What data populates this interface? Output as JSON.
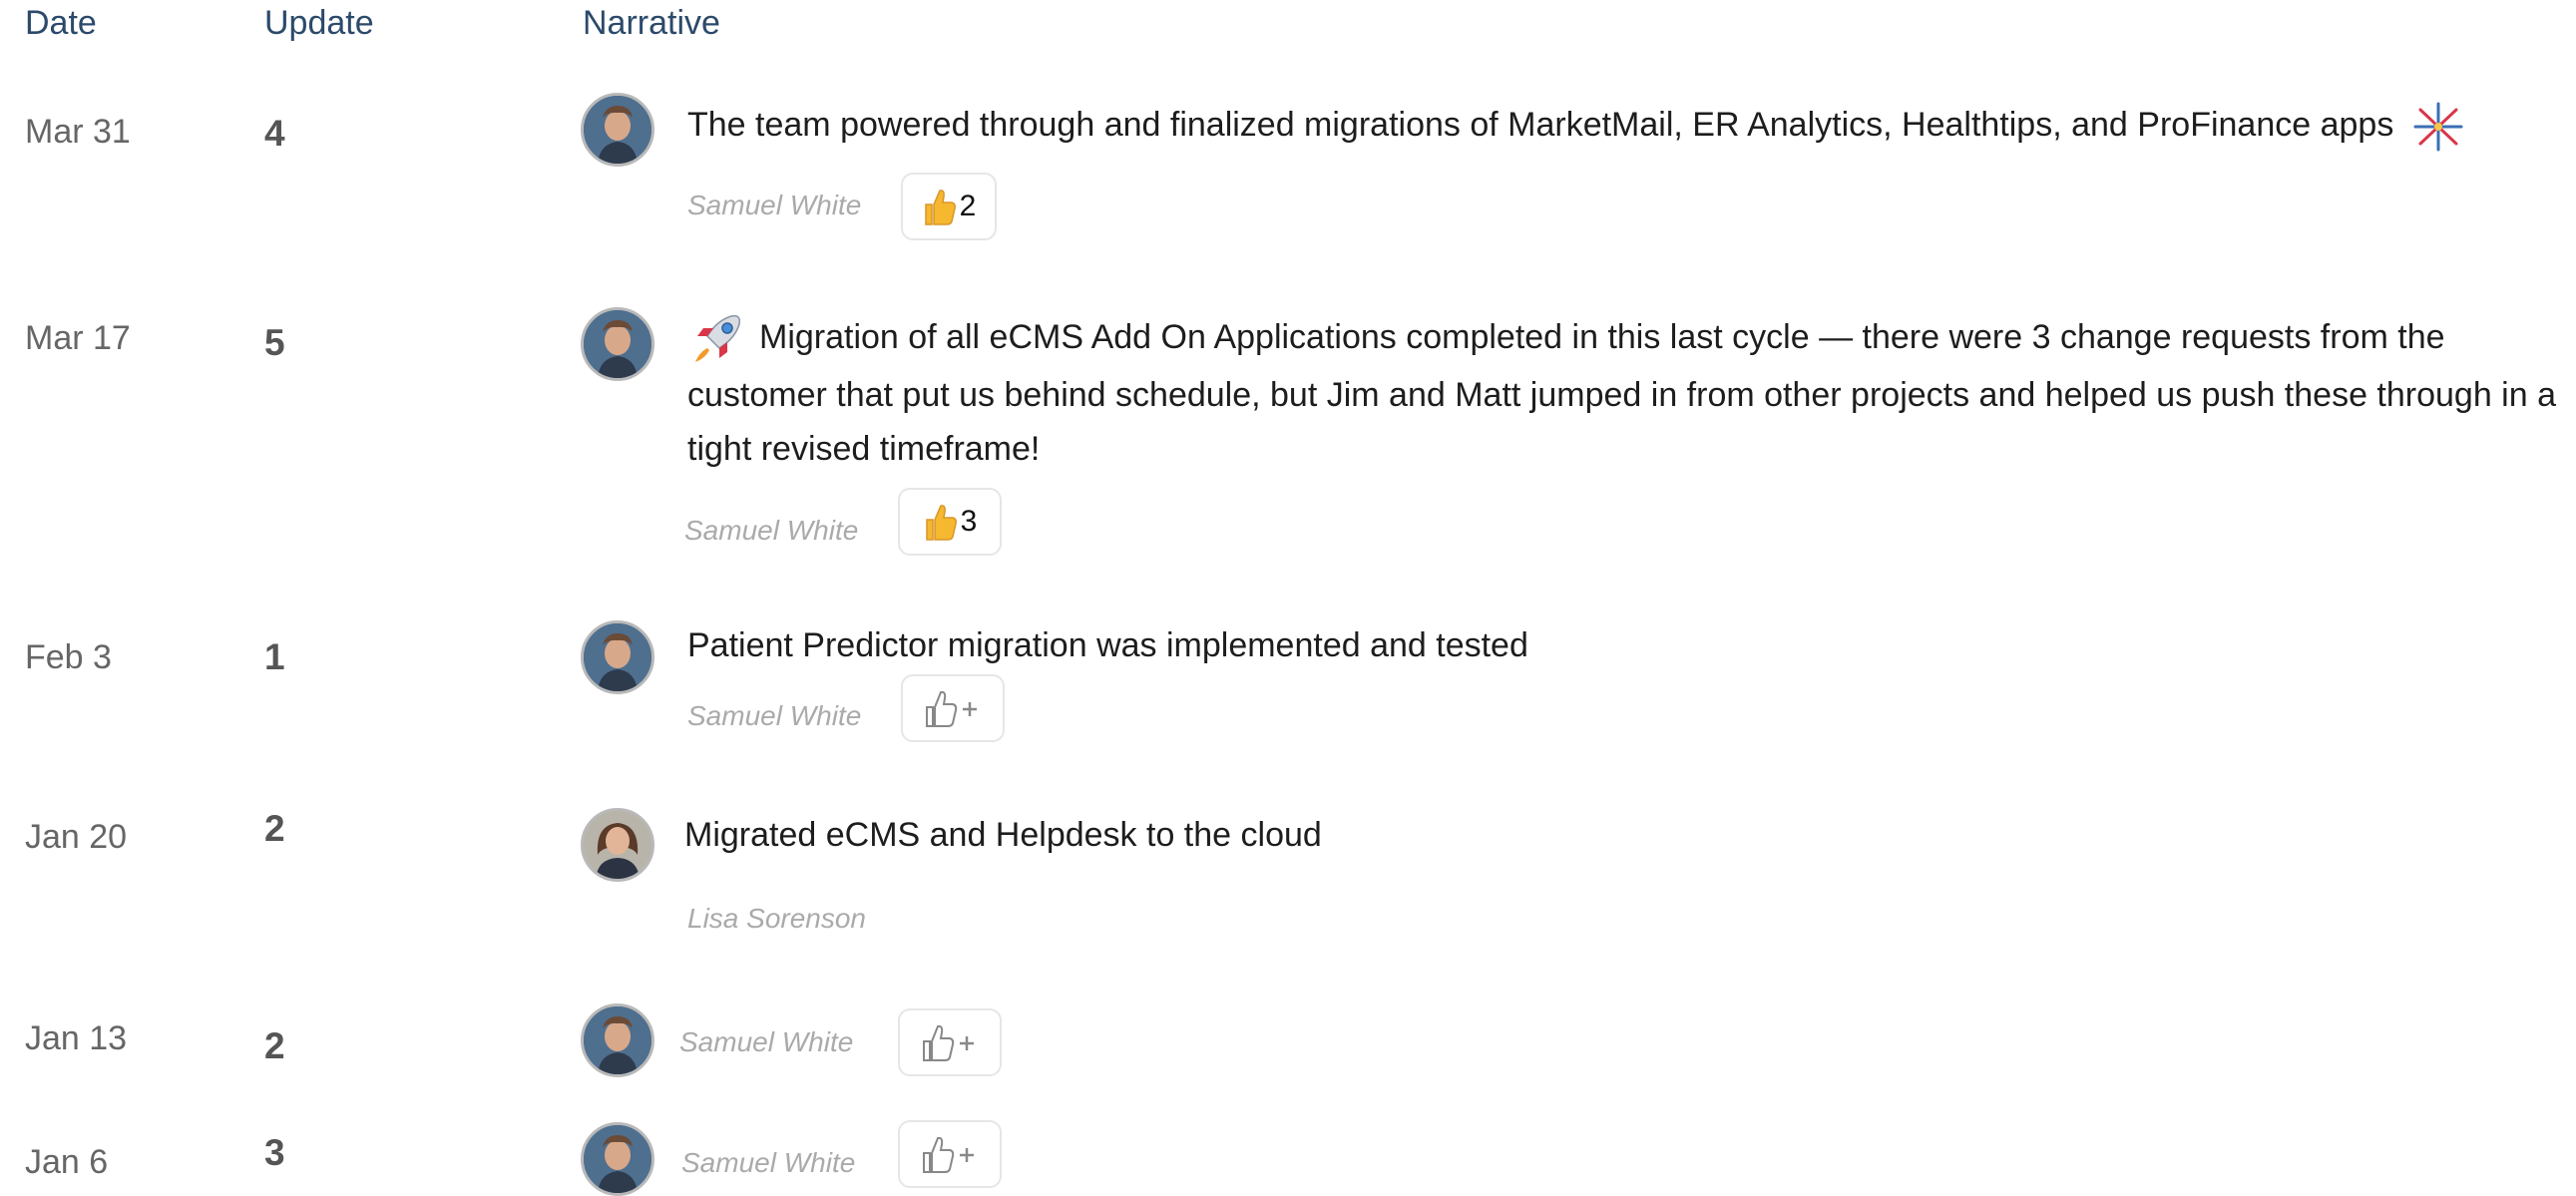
{
  "headers": {
    "date": "Date",
    "update": "Update",
    "narrative": "Narrative"
  },
  "rows": [
    {
      "date": "Mar 31",
      "update": "4",
      "narrative": "The team powered through and finalized migrations of MarketMail, ER Analytics, Healthtips, and ProFinance apps",
      "author": "Samuel White",
      "reaction_count": "2",
      "trailing_emoji": "fireworks-icon"
    },
    {
      "date": "Mar 17",
      "update": "5",
      "narrative": "Migration of all eCMS Add On Applications completed in this last cycle — there were 3 change requests from the customer that put us behind schedule, but Jim and Matt jumped in from other projects and helped us push these through in a tight revised timeframe!",
      "author": "Samuel White",
      "reaction_count": "3",
      "leading_emoji": "rocket-icon"
    },
    {
      "date": "Feb 3",
      "update": "1",
      "narrative": "Patient Predictor migration was implemented and tested",
      "author": "Samuel White",
      "reaction_count": ""
    },
    {
      "date": "Jan 20",
      "update": "2",
      "narrative": "Migrated eCMS and Helpdesk to the cloud",
      "author": "Lisa Sorenson"
    },
    {
      "date": "Jan 13",
      "update": "2",
      "narrative": "",
      "author": "Samuel White",
      "reaction_count": ""
    },
    {
      "date": "Jan 6",
      "update": "3",
      "narrative": "",
      "author": "Samuel White",
      "reaction_count": ""
    }
  ],
  "colors": {
    "header": "#2c4a6b",
    "date": "#666666",
    "author": "#aaaaaa",
    "thumb": "#f5b82e"
  }
}
